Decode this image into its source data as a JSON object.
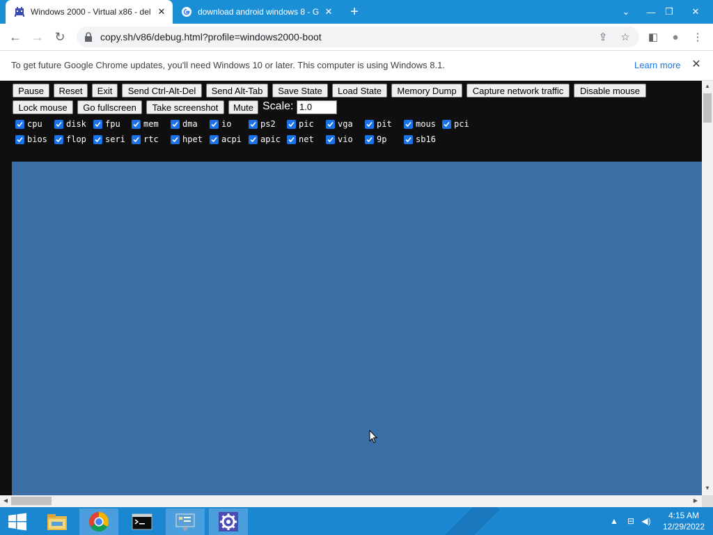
{
  "browser": {
    "tabs": [
      {
        "title": "Windows 2000 - Virtual x86 - del",
        "close": "✕",
        "active": true
      },
      {
        "title": "download android windows 8 - G",
        "close": "✕",
        "active": false
      }
    ],
    "new_tab": "+",
    "window_controls": {
      "dropdown": "⌄",
      "minimize": "—",
      "restore": "❐",
      "close": "✕"
    },
    "url": "copy.sh/v86/debug.html?profile=windows2000-boot",
    "nav": {
      "back": "←",
      "forward": "→",
      "reload": "↻"
    },
    "toolbar_icons": {
      "share": "⇪",
      "bookmark": "☆",
      "sidebar": "◧",
      "profile": "●",
      "menu": "⋮"
    },
    "infobar": {
      "message": "To get future Google Chrome updates, you'll need Windows 10 or later. This computer is using Windows 8.1.",
      "link": "Learn more",
      "close": "✕"
    }
  },
  "v86": {
    "buttons_row1": [
      "Pause",
      "Reset",
      "Exit",
      "Send Ctrl-Alt-Del",
      "Send Alt-Tab",
      "Save State",
      "Load State",
      "Memory Dump",
      "Capture network traffic",
      "Disable mouse"
    ],
    "buttons_row2": [
      "Lock mouse",
      "Go fullscreen",
      "Take screenshot",
      "Mute"
    ],
    "scale_label": "Scale:",
    "scale_value": "1.0",
    "debug_row1": [
      "cpu",
      "disk",
      "fpu",
      "mem",
      "dma",
      "io",
      "ps2",
      "pic",
      "vga",
      "pit",
      "mous",
      "pci"
    ],
    "debug_row2": [
      "bios",
      "flop",
      "seri",
      "rtc",
      "hpet",
      "acpi",
      "apic",
      "net",
      "vio",
      "9p",
      "sb16"
    ],
    "screen_color": "#3a6ea5"
  },
  "scrollbar_arrows": {
    "up": "▲",
    "down": "▼",
    "left": "◀",
    "right": "▶"
  },
  "taskbar": {
    "tray": {
      "chevron": "▲",
      "network": "⊟",
      "volume": "◀)"
    },
    "time": "4:15 AM",
    "date": "12/29/2022",
    "accent": "#1c87d1"
  }
}
